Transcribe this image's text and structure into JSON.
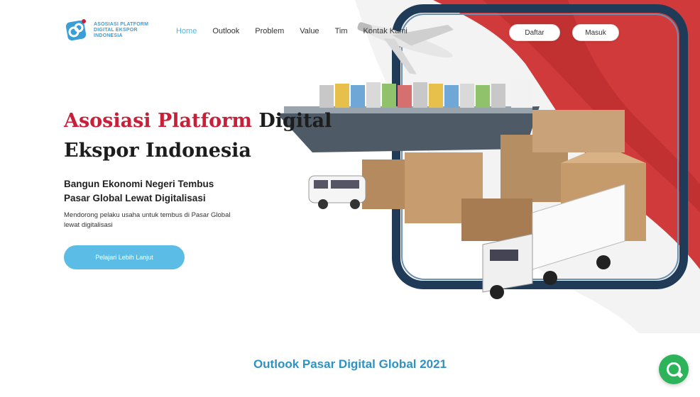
{
  "brand": {
    "logo_lines": [
      "ASOSIASI PLATFORM",
      "DIGITAL EKSPOR",
      "INDONESIA"
    ],
    "accent_color": "#5bbde6"
  },
  "nav": {
    "items": [
      {
        "label": "Home",
        "active": true
      },
      {
        "label": "Outlook",
        "active": false
      },
      {
        "label": "Problem",
        "active": false
      },
      {
        "label": "Value",
        "active": false
      },
      {
        "label": "Tim",
        "active": false
      },
      {
        "label": "Kontak Kami",
        "active": false
      }
    ],
    "daftar_label": "Daftar",
    "masuk_label": "Masuk"
  },
  "hero": {
    "title_highlight": "Asosiasi Platform",
    "title_rest_line1": "Digital",
    "title_line2": "Ekspor Indonesia",
    "subtitle": "Bangun Ekonomi Negeri Tembus Pasar Global Lewat Digitalisasi",
    "description": "Mendorong pelaku usaha untuk tembus di Pasar Global lewat digitalisasi",
    "cta_label": "Pelajari Lebih Lanjut",
    "title_red": "#c9203a"
  },
  "section": {
    "title": "Outlook Pasar Digital Global 2021"
  },
  "chat": {
    "icon": "chat-bubble-icon",
    "color": "#2db45b"
  }
}
